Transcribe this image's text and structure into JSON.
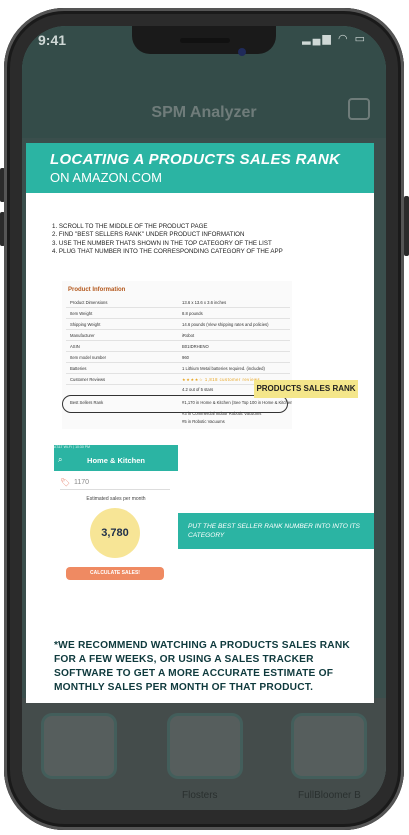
{
  "status_bar": {
    "time": "9:41",
    "icons": "▂▄▆ ◠ ▭"
  },
  "app": {
    "title": "SPM Analyzer"
  },
  "bottom_nav": [
    {
      "label": ""
    },
    {
      "label": "Flosters"
    },
    {
      "label": "FullBloomer B"
    }
  ],
  "infographic": {
    "banner_title": "LOCATING A PRODUCTS SALES RANK",
    "banner_sub": "ON AMAZON.COM",
    "steps": [
      "1. SCROLL TO THE MIDDLE OF THE PRODUCT PAGE",
      "2. FIND \"BEST SELLERS RANK\" UNDER PRODUCT INFORMATION",
      "3. USE THE NUMBER THATS SHOWN IN THE TOP CATEGORY OF THE LIST",
      "4. PLUG THAT NUMBER INTO THE CORRESPONDING CATEGORY OF THE APP"
    ],
    "product_info": {
      "title": "Product Information",
      "rows": [
        {
          "key": "Product Dimensions",
          "value": "13.6 x 13.6 x 3.6 inches"
        },
        {
          "key": "Item Weight",
          "value": "8.8 pounds"
        },
        {
          "key": "Shipping Weight",
          "value": "14.6 pounds (View shipping rates and policies)"
        },
        {
          "key": "Manufacturer",
          "value": "iRobot"
        },
        {
          "key": "ASIN",
          "value": "B01IDRHENO"
        },
        {
          "key": "Item model number",
          "value": "960"
        },
        {
          "key": "Batteries",
          "value": "1 Lithium Metal batteries required. (included)"
        },
        {
          "key": "Customer Reviews",
          "value": "★★★★☆  1,818 customer reviews"
        },
        {
          "key": "",
          "value": "4.2 out of 5 stars"
        },
        {
          "key": "Best Sellers Rank",
          "value": "#1,170 in Home & Kitchen (See Top 100 in Home & Kitchen)"
        },
        {
          "key": "",
          "value": "#3 in Commercial Indoor Robotic Vacuums"
        },
        {
          "key": "",
          "value": "#5 in Robotic Vacuums"
        }
      ]
    },
    "products_sales_rank_label": "PRODUCTS SALES RANK",
    "mini_app": {
      "status": "AT&T Wi-Fi  ⟨  10:30 PM",
      "title": "Home & Kitchen",
      "rank_value": "1170",
      "estimated_label": "Estimated sales per month",
      "estimate": "3,780",
      "button": "CALCULATE SALES!"
    },
    "put_text": "PUT THE BEST SELLER RANK NUMBER INTO INTO ITS CATEGORY",
    "note": "*WE RECOMMEND WATCHING A PRODUCTS SALES RANK FOR A FEW WEEKS, OR USING A SALES TRACKER SOFTWARE TO GET A MORE ACCURATE ESTIMATE OF MONTHLY SALES PER MONTH OF THAT PRODUCT."
  },
  "colors": {
    "teal": "#2bb4a3",
    "highlight_yellow": "#f4e68a",
    "orange": "#ef8a62",
    "link_blue": "#1a66b8"
  }
}
